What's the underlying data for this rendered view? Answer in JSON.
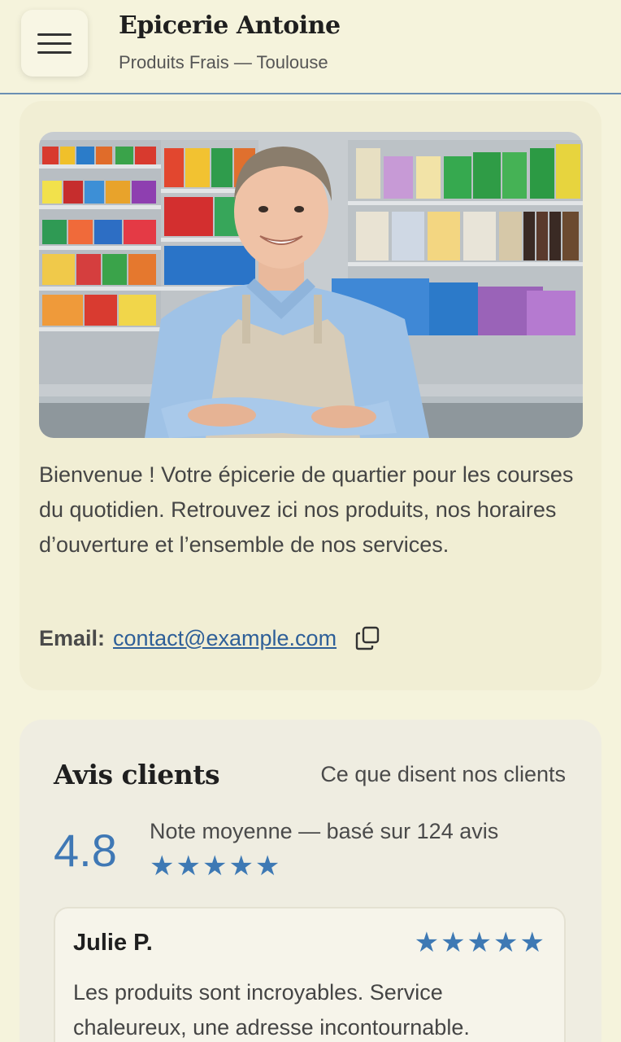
{
  "header": {
    "title": "Epicerie Antoine",
    "subtitle": "Produits Frais — Toulouse",
    "menu_icon": "hamburger-menu-icon"
  },
  "intro": {
    "photo": "shopkeeper-in-grocery-store",
    "text": "Bienvenue ! Votre épicerie de quartier pour les courses du quotidien. Retrouvez ici nos produits, nos horaires d’ouverture et l’ensemble de nos services.",
    "email_label": "Email:",
    "email": "contact@example.com",
    "copy_icon": "copy-icon"
  },
  "reviews": {
    "title": "Avis clients",
    "subtitle": "Ce que disent nos clients",
    "average": "4.8",
    "average_label": "Note moyenne — basé sur 124 avis",
    "average_stars": "★★★★★",
    "items": [
      {
        "name": "Julie P.",
        "stars": "★★★★★",
        "text": "Les produits sont incroyables. Service chaleureux, une adresse incontournable."
      }
    ]
  },
  "colors": {
    "background": "#f5f3dc",
    "accent": "#3e79b4",
    "link": "#2e5f98"
  }
}
